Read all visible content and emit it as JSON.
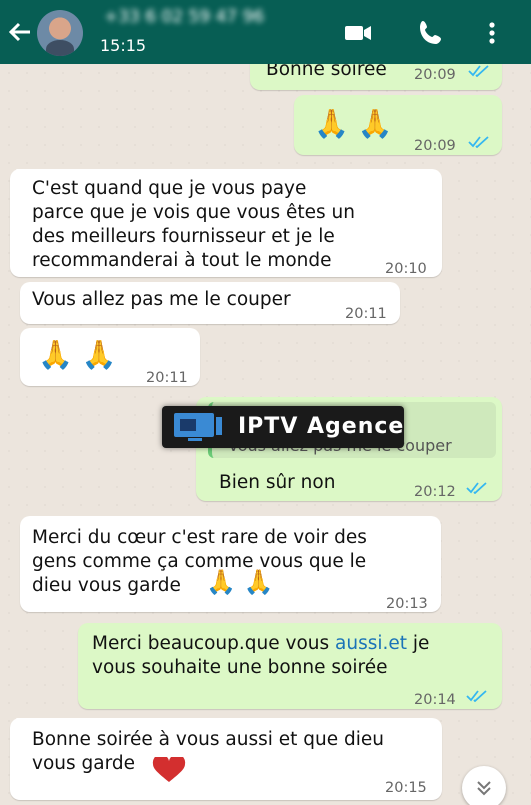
{
  "header": {
    "contact_name": "+33 6 02 59 47 96",
    "last_seen_time": "15:15",
    "bar_color": "#075e54"
  },
  "messages": [
    {
      "direction": "out",
      "text": "Bonne soirée",
      "time": "20:09",
      "read": true
    },
    {
      "direction": "out",
      "text": "🙏 🙏",
      "time": "20:09",
      "read": true
    },
    {
      "direction": "in",
      "text": "C'est quand que je vous paye\nparce que je vois que vous êtes un\ndes meilleurs fournisseur et je le\nrecommanderai à tout le monde",
      "time": "20:10"
    },
    {
      "direction": "in",
      "text": "Vous allez pas me le couper",
      "time": "20:11"
    },
    {
      "direction": "in",
      "text": "🙏 🙏",
      "time": "20:11"
    },
    {
      "direction": "out",
      "quoted_sender": "96",
      "quoted_text": "Vous allez pas me le couper",
      "text": "Bien sûr non",
      "time": "20:12",
      "read": true
    },
    {
      "direction": "in",
      "text": "Merci du cœur c'est rare de voir des\ngens comme ça comme vous que le\ndieu vous garde",
      "time": "20:13"
    },
    {
      "direction": "out",
      "text_before_link": "Merci beaucoup.que  vous ",
      "link": "aussi.et",
      "text_after_link": " je\nvous souhaite une bonne soirée",
      "time": "20:14",
      "read": true
    },
    {
      "direction": "in",
      "text": "Bonne soirée à vous aussi et que dieu\nvous garde",
      "time": "20:15"
    }
  ],
  "watermark": {
    "text": "IPTV Agence"
  },
  "colors": {
    "incoming": "#ffffff",
    "outgoing": "#dcf8c6",
    "read_ticks": "#34b7f1",
    "heart": "#d32f2f"
  }
}
